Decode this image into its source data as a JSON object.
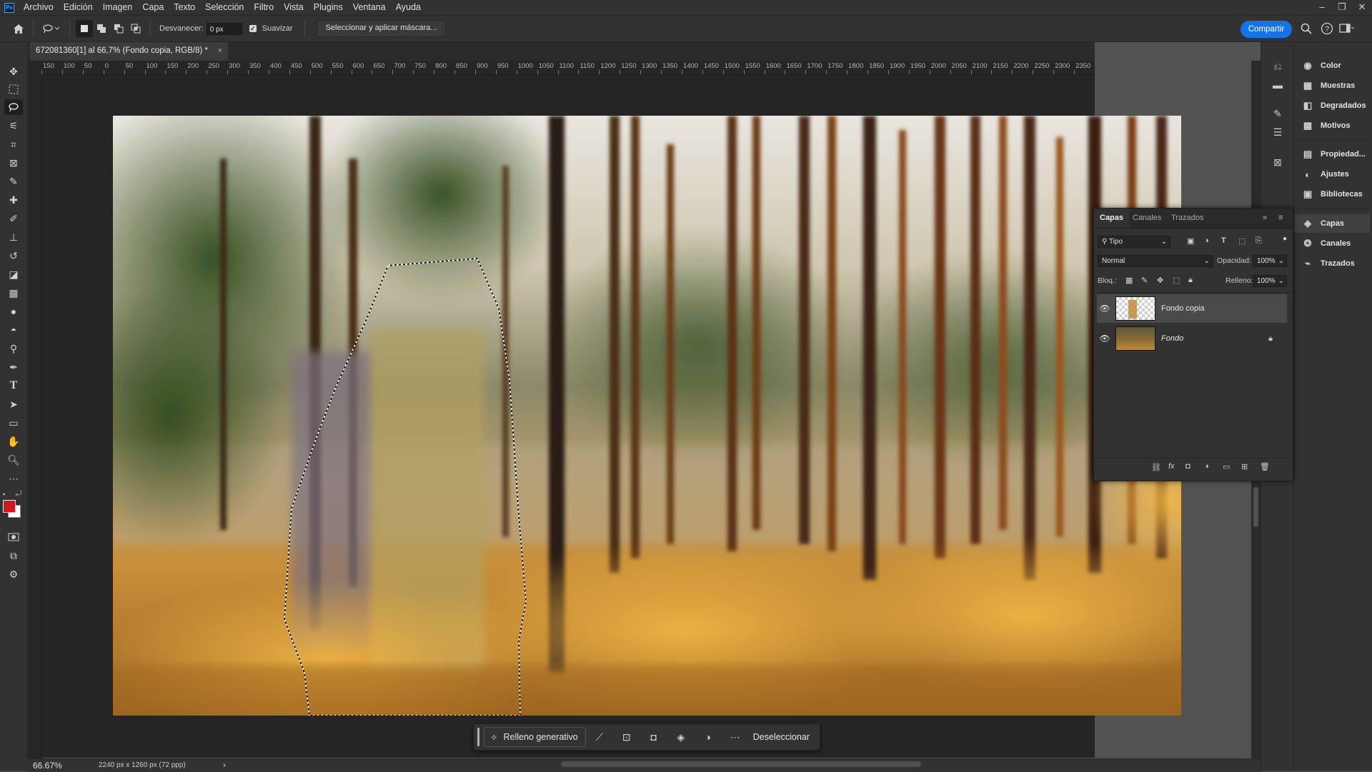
{
  "menu": {
    "logo": "Ps",
    "items": [
      "Archivo",
      "Edición",
      "Imagen",
      "Capa",
      "Texto",
      "Selección",
      "Filtro",
      "Vista",
      "Plugins",
      "Ventana",
      "Ayuda"
    ]
  },
  "window_controls": {
    "minimize": "–",
    "restore": "❐",
    "close": "✕"
  },
  "options_bar": {
    "feather_label": "Desvanecer:",
    "feather_value": "0 px",
    "antialias_label": "Suavizar",
    "antialias_checked": true,
    "mask_button": "Seleccionar y aplicar máscara...",
    "share_button": "Compartir"
  },
  "document": {
    "tab_title": "672081360[1] al 66,7% (Fondo copia, RGB/8) *",
    "close": "×"
  },
  "ruler": {
    "top_labels": [
      "150",
      "100",
      "50",
      "0",
      "50",
      "100",
      "150",
      "200",
      "250",
      "300",
      "350",
      "400",
      "450",
      "500",
      "550",
      "600",
      "650",
      "700",
      "750",
      "800",
      "850",
      "900",
      "950",
      "1000",
      "1050",
      "1100",
      "1150",
      "1200",
      "1250",
      "1300",
      "1350",
      "1400",
      "1450",
      "1500",
      "1550",
      "1600",
      "1650",
      "1700",
      "1750",
      "1800",
      "1850",
      "1900",
      "1950",
      "2000",
      "2050",
      "2100",
      "2150",
      "2200",
      "2250",
      "2300",
      "2350"
    ]
  },
  "status": {
    "zoom": "66.67%",
    "doc_size": "2240 px x 1260 px (72 ppp)",
    "arrow": "›"
  },
  "contextual_bar": {
    "generative_fill": "Relleno generativo",
    "deselect": "Deseleccionar"
  },
  "right_panel": {
    "items": [
      {
        "label": "Color",
        "icon": "color-icon"
      },
      {
        "label": "Muestras",
        "icon": "swatches-icon"
      },
      {
        "label": "Degradados",
        "icon": "gradients-icon"
      },
      {
        "label": "Motivos",
        "icon": "patterns-icon"
      },
      {
        "label": "Propiedad...",
        "icon": "properties-icon"
      },
      {
        "label": "Ajustes",
        "icon": "adjustments-icon"
      },
      {
        "label": "Bibliotecas",
        "icon": "libraries-icon"
      },
      {
        "label": "Capas",
        "icon": "layers-icon"
      },
      {
        "label": "Canales",
        "icon": "channels-icon"
      },
      {
        "label": "Trazados",
        "icon": "paths-icon"
      }
    ]
  },
  "layers_panel": {
    "tabs": [
      "Capas",
      "Canales",
      "Trazados"
    ],
    "filter_kind": "Tipo",
    "blend_mode": "Normal",
    "opacity_label": "Opacidad:",
    "opacity_value": "100%",
    "lock_label": "Bloq.:",
    "fill_label": "Relleno:",
    "fill_value": "100%",
    "layers": [
      {
        "name": "Fondo copia",
        "visible": true,
        "selected": true,
        "locked": false
      },
      {
        "name": "Fondo",
        "visible": true,
        "selected": false,
        "locked": true
      }
    ]
  },
  "colors": {
    "foreground": "#d0181a",
    "background": "#ffffff",
    "accent": "#1473e6"
  }
}
